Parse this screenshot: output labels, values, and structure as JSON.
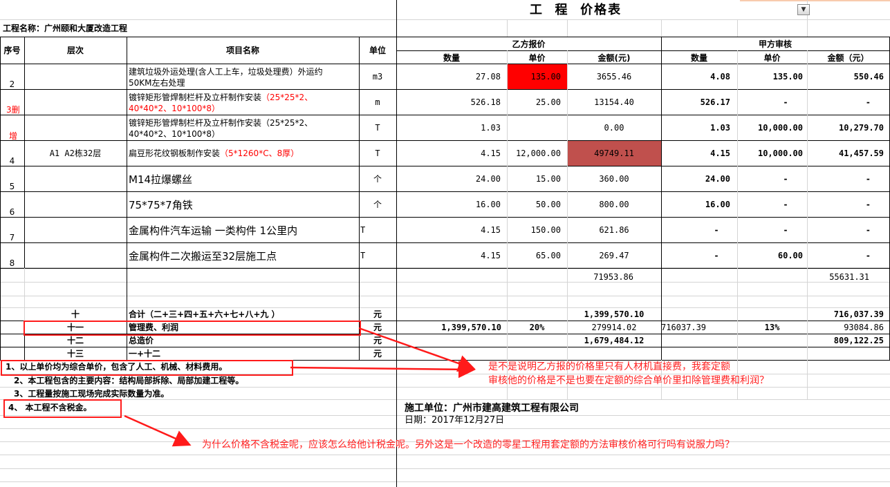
{
  "sheet_title": "工  程  价格表",
  "project_label": "工程名称：广州颐和大厦改造工程",
  "headers": {
    "no": "序号",
    "floor": "层次",
    "item": "项目名称",
    "unit": "单位",
    "party_b": "乙方报价",
    "party_a": "甲方审核",
    "qty": "数量",
    "price": "单价",
    "amount": "金额(元)",
    "amount_a": "金额（元）"
  },
  "floor_value": "A1 A2栋32层",
  "rows": [
    {
      "no": "2",
      "item": [
        "建筑垃圾外运处理(含人工上车，垃圾处理费）外运约",
        "50KM左右处理"
      ],
      "unit": "m3",
      "b_qty": "27.08",
      "b_price": "135.00",
      "b_amt": "3655.46",
      "a_qty": "4.08",
      "a_price": "135.00",
      "a_amt": "550.46"
    },
    {
      "no": "",
      "item": [
        "镀锌矩形管焊制栏杆及立杆制作安装",
        "（25*25*2、",
        "40*40*2、10*100*8）"
      ],
      "unit": "m",
      "b_qty": "526.18",
      "b_price": "25.00",
      "b_amt": "13154.40",
      "a_qty": "526.17",
      "a_price": "-",
      "a_amt": "-"
    },
    {
      "no": "",
      "item": [
        "镀锌矩形管焊制栏杆及立杆制作安装（25*25*2、",
        "40*40*2、10*100*8）"
      ],
      "unit": "T",
      "b_qty": "1.03",
      "b_price": "",
      "b_amt": "0.00",
      "a_qty": "1.03",
      "a_price": "10,000.00",
      "a_amt": "10,279.70"
    },
    {
      "no": "4",
      "item": [
        "扁豆形花纹钢板制作安装",
        "（5*1260*C、8厚）"
      ],
      "unit": "T",
      "b_qty": "4.15",
      "b_price": "12,000.00",
      "b_amt": "49749.11",
      "a_qty": "4.15",
      "a_price": "10,000.00",
      "a_amt": "41,457.59"
    },
    {
      "no": "5",
      "item": [
        "M14拉爆螺丝"
      ],
      "unit": "个",
      "b_qty": "24.00",
      "b_price": "15.00",
      "b_amt": "360.00",
      "a_qty": "24.00",
      "a_price": "-",
      "a_amt": "-"
    },
    {
      "no": "6",
      "item": [
        "75*75*7角铁"
      ],
      "unit": "个",
      "b_qty": "16.00",
      "b_price": "50.00",
      "b_amt": "800.00",
      "a_qty": "16.00",
      "a_price": "-",
      "a_amt": "-"
    },
    {
      "no": "7",
      "item": [
        "金属构件汽车运输  一类构件 1公里内"
      ],
      "unit": "T",
      "b_qty": "4.15",
      "b_price": "150.00",
      "b_amt": "621.86",
      "a_qty": "-",
      "a_price": "-",
      "a_amt": "-"
    },
    {
      "no": "8",
      "item": [
        "金属构件二次搬运至32层施工点"
      ],
      "unit": "T",
      "b_qty": "4.15",
      "b_price": "65.00",
      "b_amt": "269.47",
      "a_qty": "-",
      "a_price": "60.00",
      "a_amt": "-"
    }
  ],
  "row3_no_top": "3删",
  "row3_no_bottom": "增",
  "subtotal": {
    "b_amt": "71953.86",
    "a_amt": "55631.31"
  },
  "summary": [
    {
      "code": "十",
      "name": "合计（二+三+四+五+六+七+八+九 ）",
      "unit": "元",
      "b_qty": "",
      "b_price": "",
      "b_amt": "1,399,570.10",
      "a_qty": "",
      "a_price": "",
      "a_amt": "716,037.39"
    },
    {
      "code": "十一",
      "name": "管理费、利润",
      "unit": "元",
      "b_qty": "1,399,570.10",
      "b_price": "20%",
      "b_amt": "279914.02",
      "a_qty": "716037.39",
      "a_price": "13%",
      "a_amt": "93084.86"
    },
    {
      "code": "十二",
      "name": "总造价",
      "unit": "元",
      "b_qty": "",
      "b_price": "",
      "b_amt": "1,679,484.12",
      "a_qty": "",
      "a_price": "",
      "a_amt": "809,122.25"
    },
    {
      "code": "十三",
      "name": "一+十二",
      "unit": "元",
      "b_qty": "",
      "b_price": "",
      "b_amt": "",
      "a_qty": "",
      "a_price": "",
      "a_amt": ""
    }
  ],
  "notes": [
    "1、以上单价均为综合单价，包含了人工、机械、材料费用。",
    "2、本工程包含的主要内容：结构局部拆除、局部加建工程等。",
    "3、工程量按施工现场完成实际数量为准。",
    "4、 本工程不含税金。"
  ],
  "contractor": "施工单位：广州市建高建筑工程有限公司",
  "date": "日期：2017年12月27日",
  "annotations": [
    "是不是说明乙方报的价格里只有人材机直接费，我套定额",
    "审核他的价格是不是也要在定额的综合单价里扣除管理费和利润？",
    "为什么价格不含税金呢，应该怎么给他计税金呢。另外这是一个改造的零星工程用套定额的方法审核价格可行吗有说服力吗？"
  ],
  "colors": {
    "highlight_red": "#ff0000",
    "highlight_brick": "#c0504d",
    "annotation": "#ff2020",
    "title_bg": "#fde9d9"
  }
}
